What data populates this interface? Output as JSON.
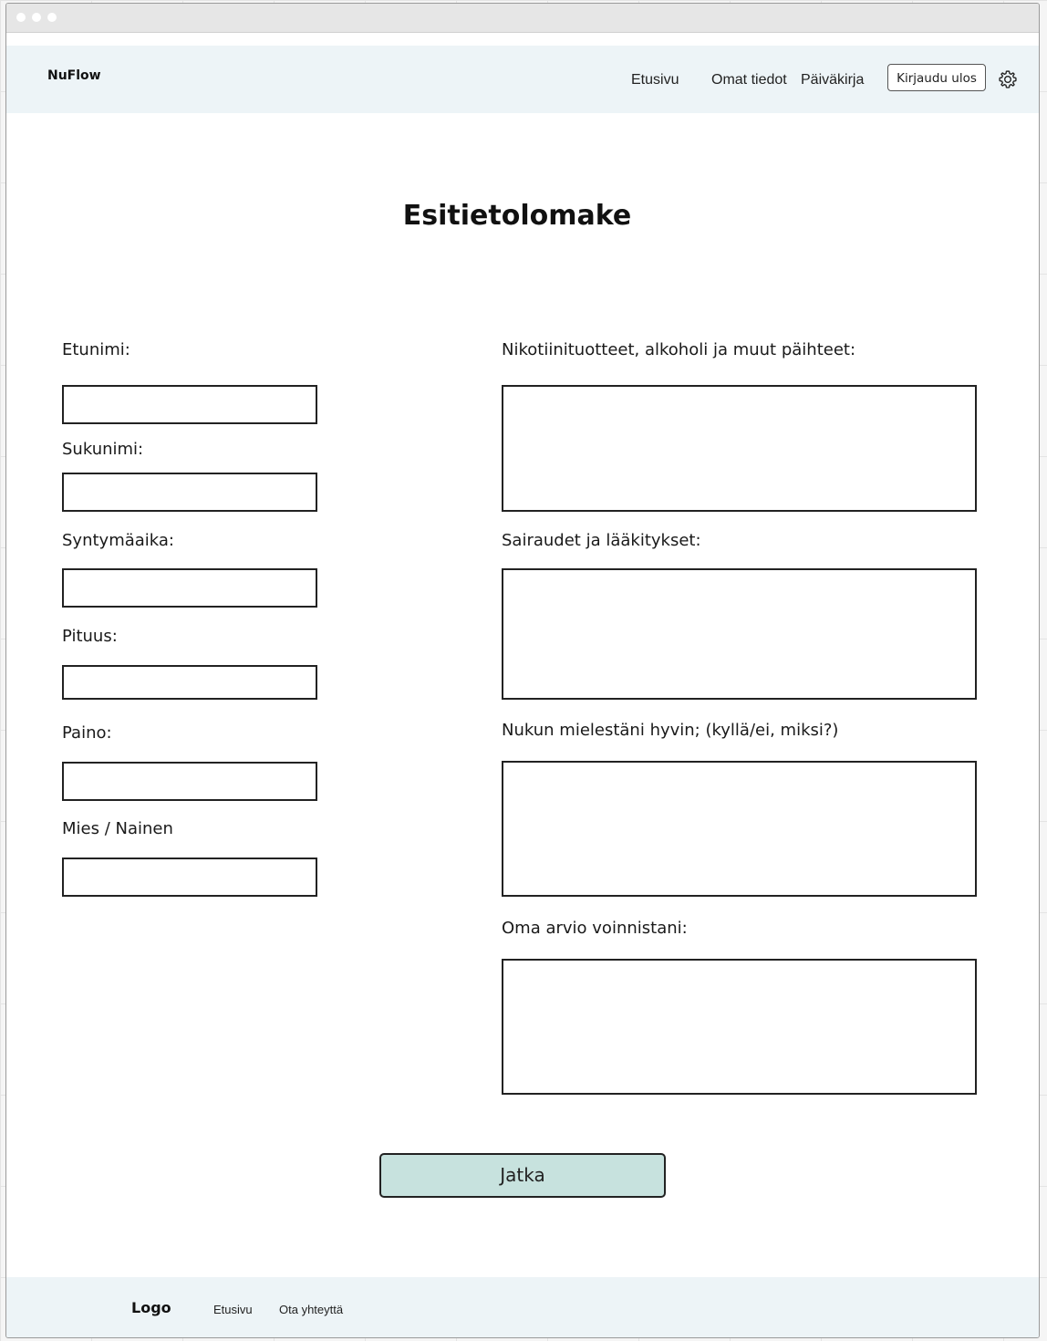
{
  "app": {
    "brand": "NuFlow"
  },
  "nav": {
    "items": [
      "Etusivu",
      "Omat tiedot",
      "Päiväkirja"
    ],
    "logout_label": "Kirjaudu ulos"
  },
  "form": {
    "title": "Esitietolomake",
    "left_fields": [
      {
        "label": "Etunimi:",
        "value": ""
      },
      {
        "label": "Sukunimi:",
        "value": ""
      },
      {
        "label": "Syntymäaika:",
        "value": ""
      },
      {
        "label": "Pituus:",
        "value": ""
      },
      {
        "label": "Paino:",
        "value": ""
      },
      {
        "label": "Mies / Nainen",
        "value": ""
      }
    ],
    "right_fields": [
      {
        "label": "Nikotiinituotteet, alkoholi ja muut päihteet:",
        "value": ""
      },
      {
        "label": "Sairaudet ja lääkitykset:",
        "value": ""
      },
      {
        "label": "Nukun mielestäni hyvin; (kyllä/ei, miksi?)",
        "value": ""
      },
      {
        "label": "Oma arvio voinnistani:",
        "value": ""
      }
    ],
    "submit_label": "Jatka"
  },
  "footer": {
    "logo": "Logo",
    "links": [
      "Etusivu",
      "Ota yhteyttä"
    ]
  }
}
